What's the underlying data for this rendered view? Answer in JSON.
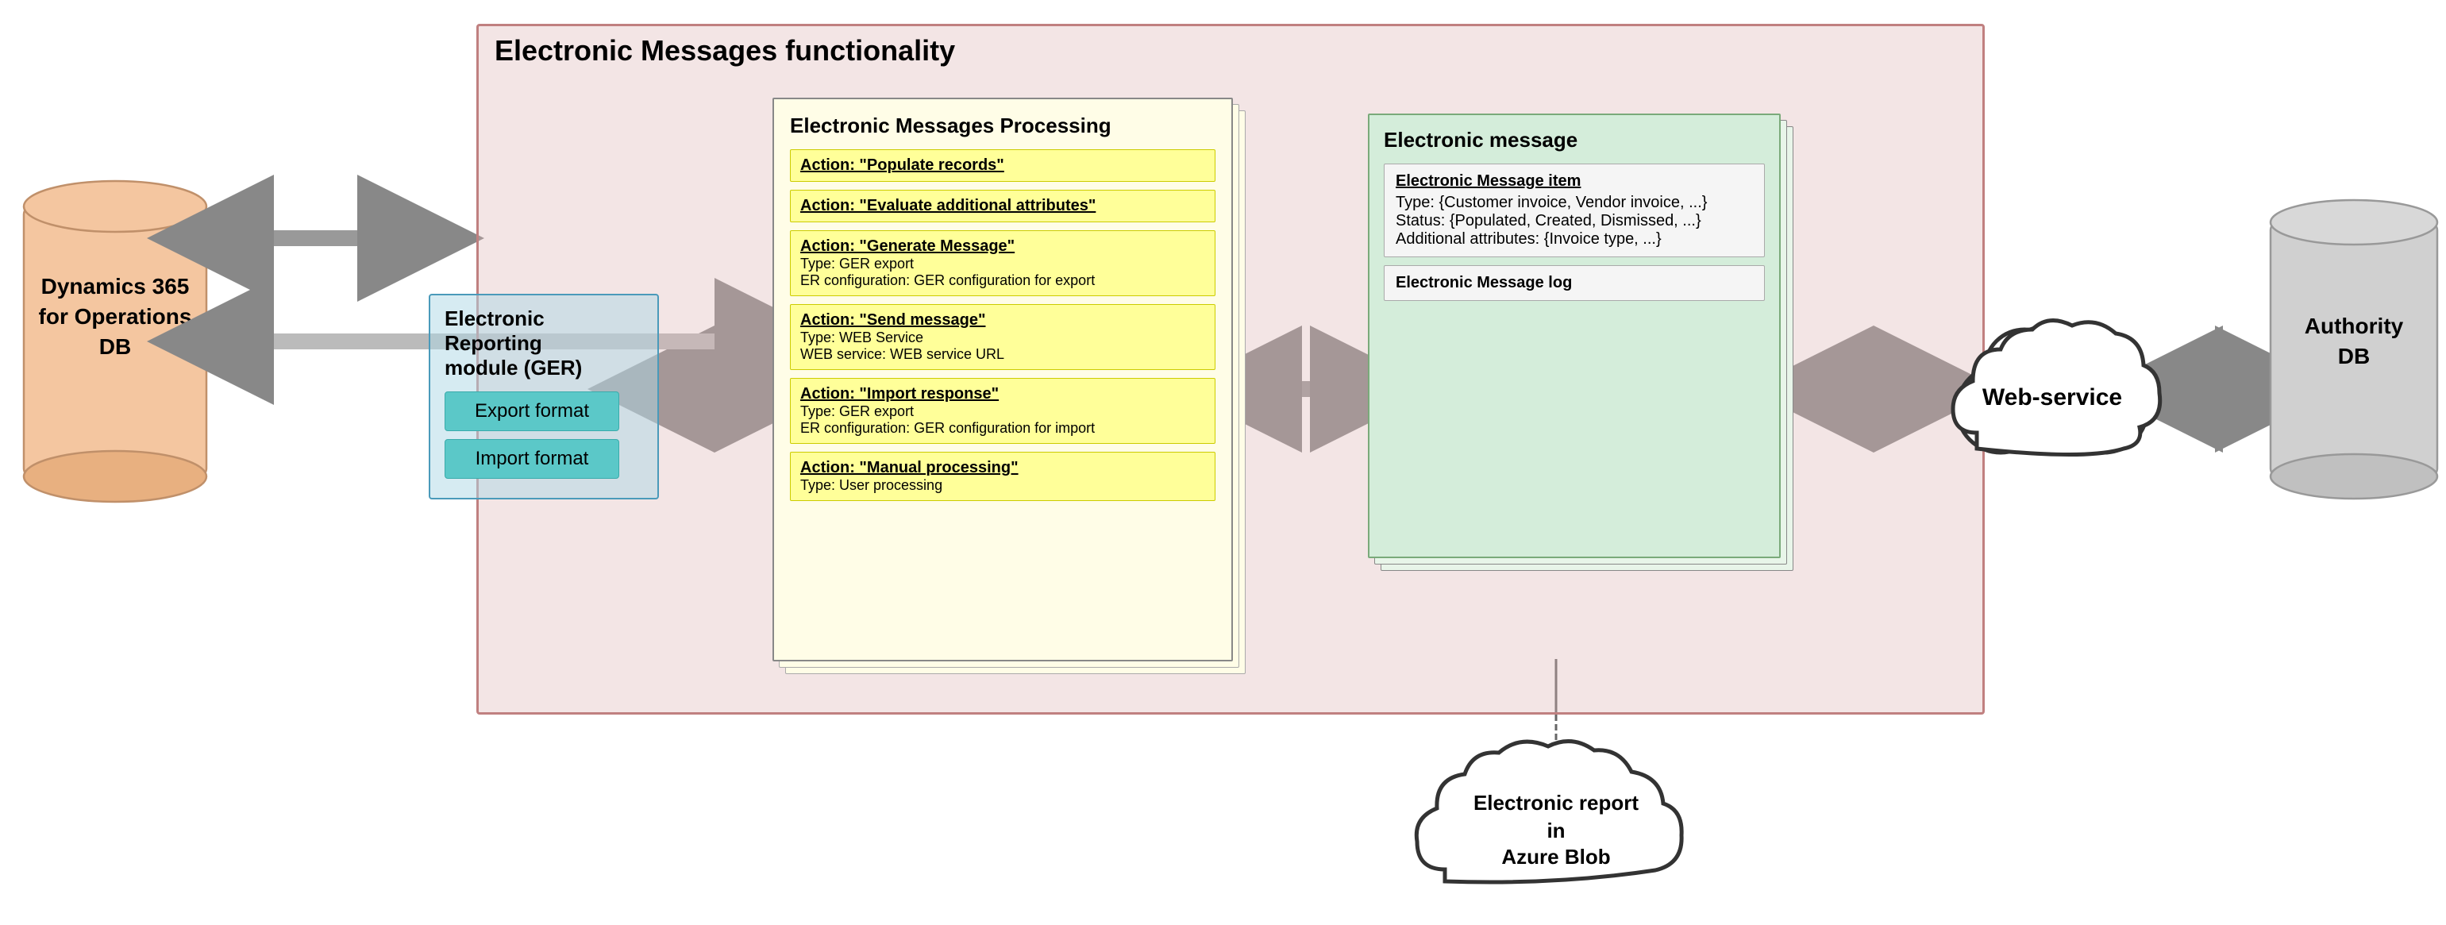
{
  "title": "Electronic Messages functionality",
  "dynamics_db": {
    "line1": "Dynamics 365",
    "line2": "for Operations",
    "line3": "DB"
  },
  "er_module": {
    "title": "Electronic Reporting\nmodule (GER)",
    "export_format": "Export format",
    "import_format": "Import format"
  },
  "processing": {
    "title": "Electronic Messages Processing",
    "actions": [
      {
        "action": "Action: \"Populate records\""
      },
      {
        "action": "Action: \"Evaluate additional attributes\""
      },
      {
        "action": "Action: \"Generate Message\"",
        "sub1": "Type: GER export",
        "sub2": "ER configuration: GER configuration for export"
      },
      {
        "action": "Action: \"Send message\"",
        "sub1": "Type: WEB Service",
        "sub2": "WEB service: WEB service URL"
      },
      {
        "action": "Action: \"Import response\"",
        "sub1": "Type: GER export",
        "sub2": "ER configuration: GER configuration for import"
      },
      {
        "action": "Action: \"Manual processing\"",
        "sub1": "Type: User processing"
      }
    ]
  },
  "electronic_message": {
    "title": "Electronic message",
    "item": {
      "title": "Electronic Message item",
      "type": "Type: {Customer invoice, Vendor invoice, ...}",
      "status": "Status: {Populated, Created, Dismissed, ...}",
      "additional": "Additional attributes: {Invoice type, ...}"
    },
    "log": "Electronic Message log"
  },
  "web_service": {
    "label": "Web-service"
  },
  "authority_db": {
    "label": "Authority\nDB"
  },
  "azure_blob": {
    "line1": "Electronic report",
    "line2": "in",
    "line3": "Azure Blob"
  }
}
